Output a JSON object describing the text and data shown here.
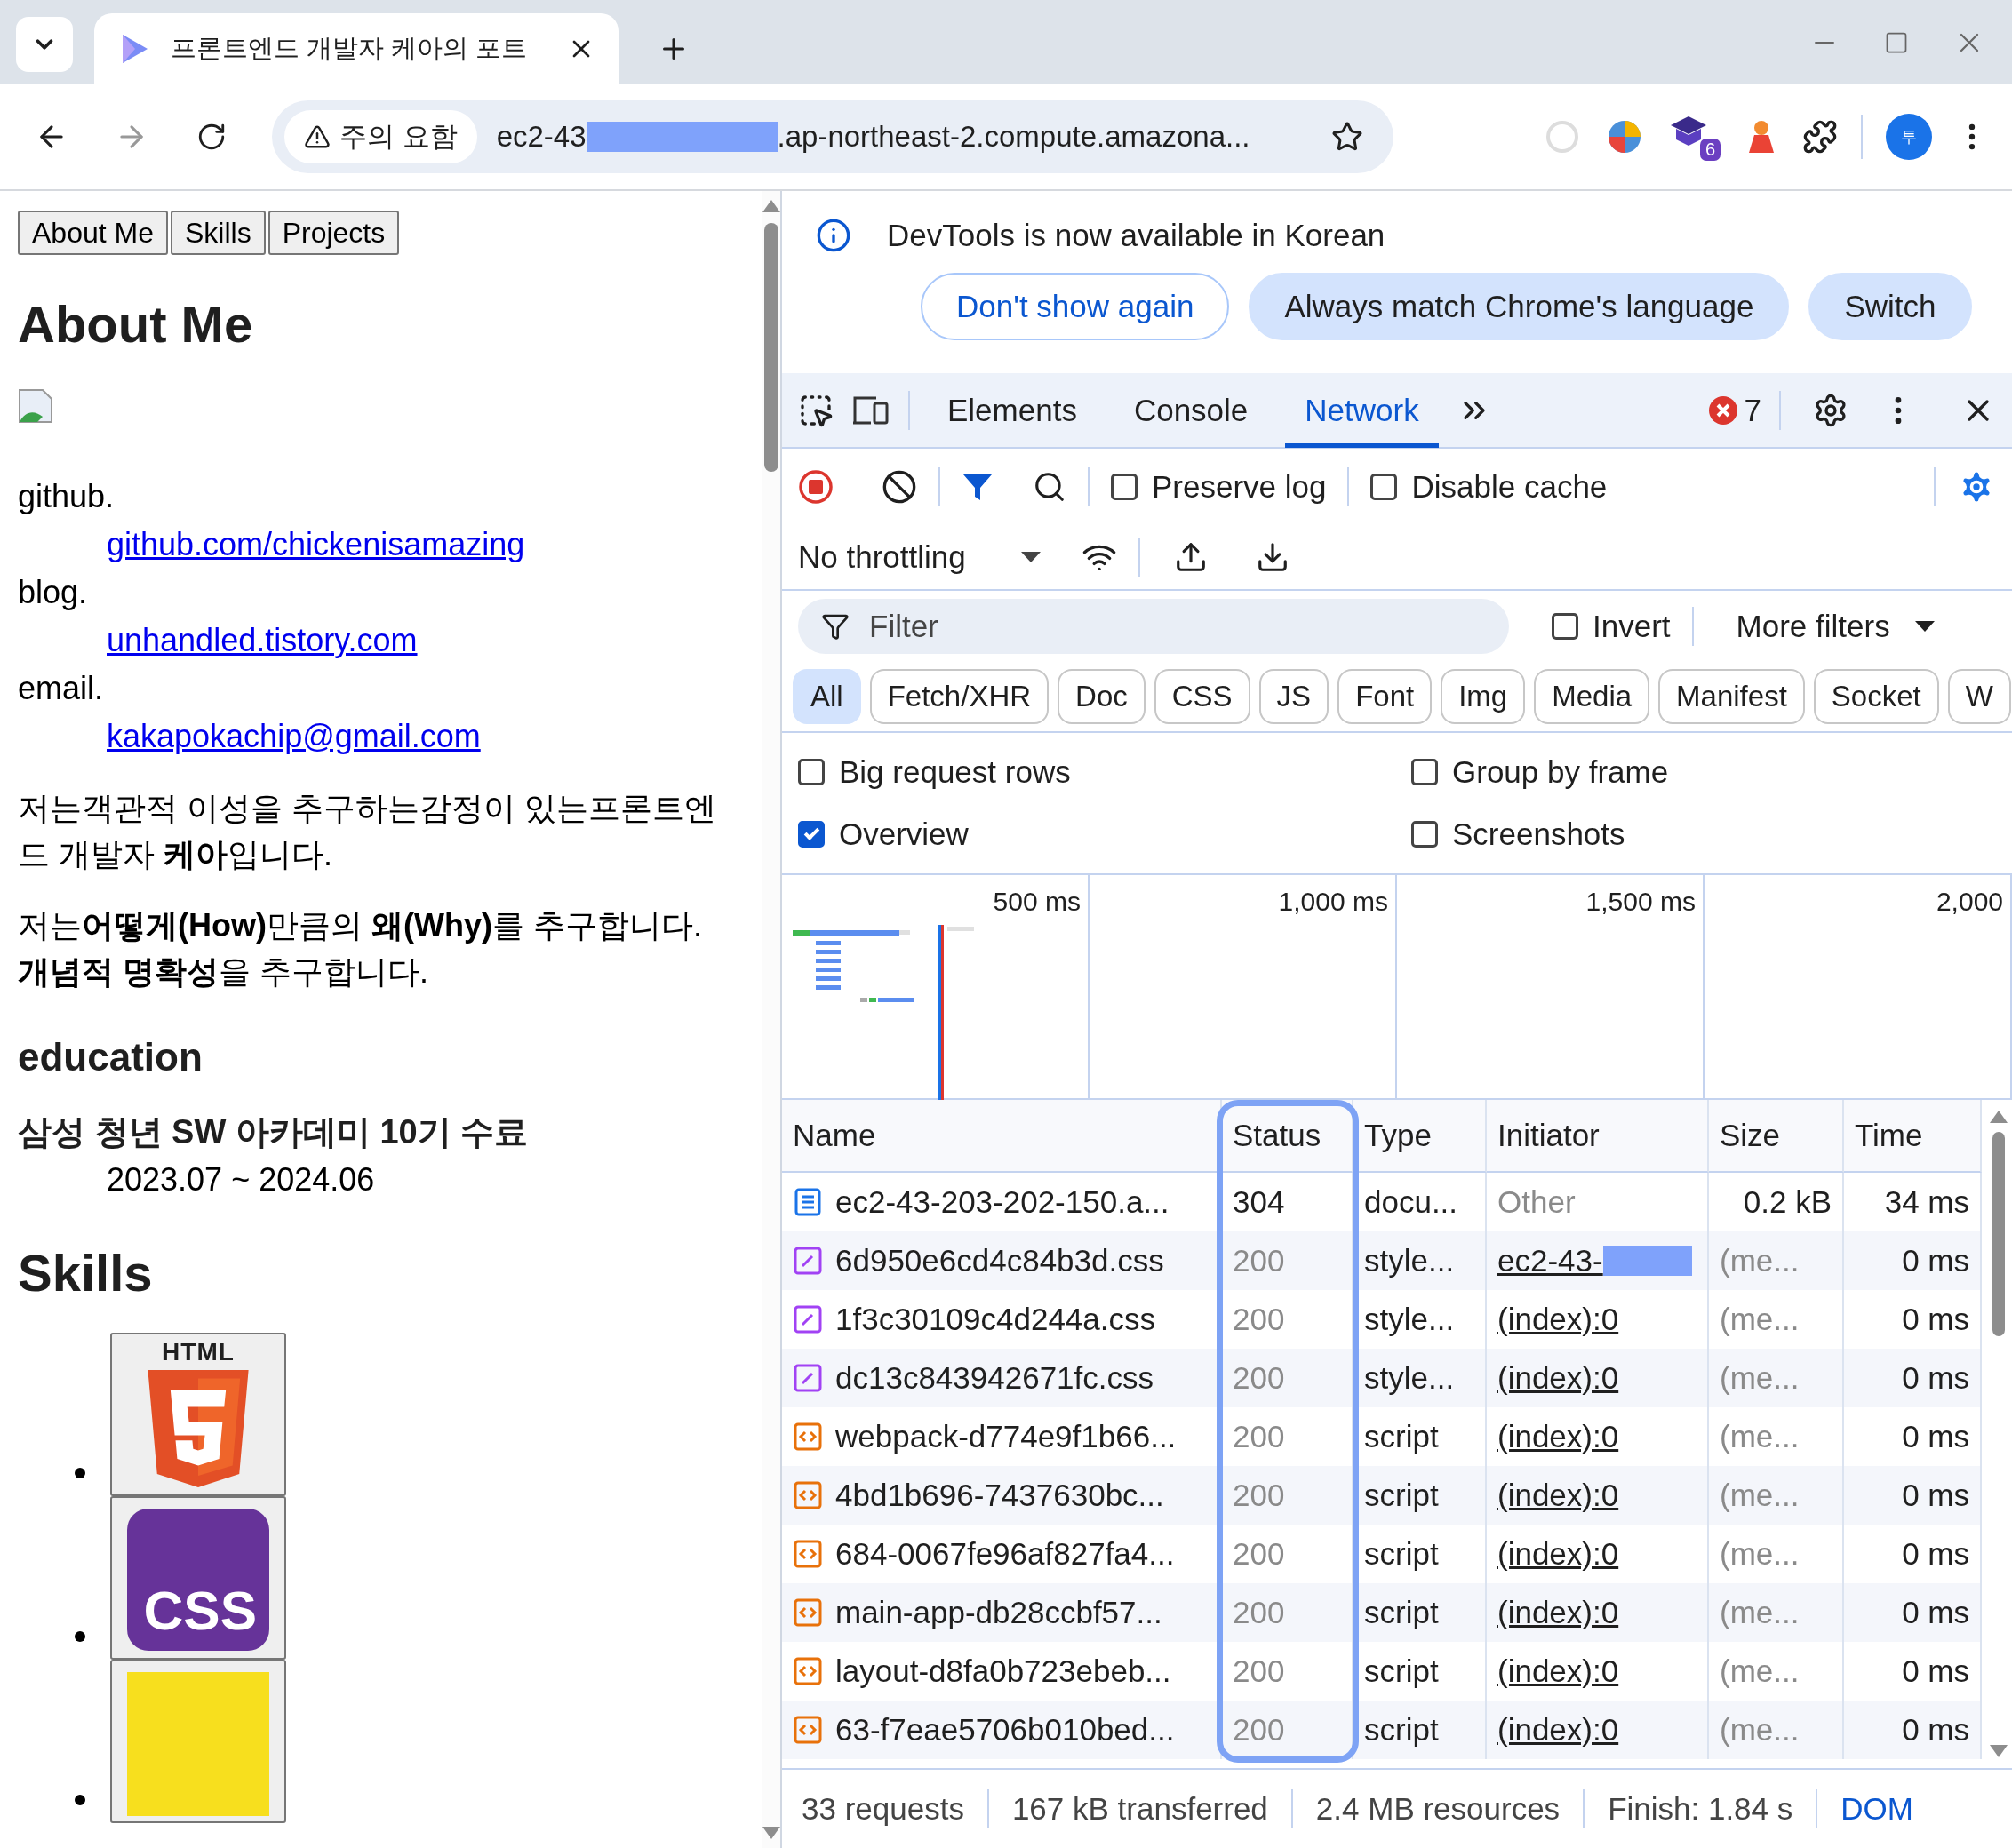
{
  "browser": {
    "tab": {
      "title": "프론트엔드 개발자 케아의 포트"
    },
    "address": {
      "security_label": "주의 요함",
      "url_prefix": "ec2-43",
      "url_suffix": ".ap-northeast-2.compute.amazona..."
    },
    "extensions_badge": "6",
    "profile_initial": "투"
  },
  "page": {
    "nav_buttons": [
      "About Me",
      "Skills",
      "Projects"
    ],
    "heading": "About Me",
    "contacts": [
      {
        "label": "github.",
        "link": "github.com/chickenisamazing"
      },
      {
        "label": "blog.",
        "link": "unhandled.tistory.com"
      },
      {
        "label": "email.",
        "link": "kakapokachip@gmail.com"
      }
    ],
    "paragraphs": [
      "저는객관적 이성을 추구하는감정이 있는프론트엔드 개발자 **케아**입니다.",
      "저는**어떻게(How)**만큼의 **왜(Why)**를 추구합니다.**개념적 명확성**을 추구합니다."
    ],
    "education_heading": "education",
    "education": {
      "title": "삼성 청년 SW 아카데미 10기 수료",
      "period": "2023.07 ~ 2024.06"
    },
    "skills_heading": "Skills",
    "skills": [
      {
        "kind": "html",
        "label": "HTML"
      },
      {
        "kind": "css",
        "label": "CSS"
      },
      {
        "kind": "js"
      }
    ]
  },
  "devtools": {
    "banner": {
      "message": "DevTools is now available in Korean",
      "buttons": [
        {
          "label": "Don't show again",
          "kind": "outline"
        },
        {
          "label": "Always match Chrome's language",
          "kind": "filled"
        },
        {
          "label": "Switch",
          "kind": "filled"
        }
      ]
    },
    "tabs": [
      {
        "label": "Elements",
        "selected": false
      },
      {
        "label": "Console",
        "selected": false
      },
      {
        "label": "Network",
        "selected": true
      }
    ],
    "error_count": "7",
    "preserve_log": {
      "label": "Preserve log",
      "checked": false
    },
    "disable_cache": {
      "label": "Disable cache",
      "checked": false
    },
    "throttling": "No throttling",
    "filter": {
      "placeholder": "Filter"
    },
    "invert": {
      "label": "Invert",
      "checked": false
    },
    "more_filters": "More filters",
    "type_filters": [
      {
        "label": "All",
        "selected": true
      },
      {
        "label": "Fetch/XHR",
        "selected": false
      },
      {
        "label": "Doc",
        "selected": false
      },
      {
        "label": "CSS",
        "selected": false
      },
      {
        "label": "JS",
        "selected": false
      },
      {
        "label": "Font",
        "selected": false
      },
      {
        "label": "Img",
        "selected": false
      },
      {
        "label": "Media",
        "selected": false
      },
      {
        "label": "Manifest",
        "selected": false
      },
      {
        "label": "Socket",
        "selected": false
      },
      {
        "label": "W",
        "selected": false
      }
    ],
    "options": [
      {
        "label": "Big request rows",
        "checked": false
      },
      {
        "label": "Group by frame",
        "checked": false
      },
      {
        "label": "Overview",
        "checked": true
      },
      {
        "label": "Screenshots",
        "checked": false
      }
    ],
    "overview_ticks": [
      "500 ms",
      "1,000 ms",
      "1,500 ms",
      "2,000"
    ],
    "table": {
      "columns": [
        {
          "label": "Name",
          "highlighted": false
        },
        {
          "label": "Status",
          "highlighted": true
        },
        {
          "label": "Type",
          "highlighted": false
        },
        {
          "label": "Initiator",
          "highlighted": false
        },
        {
          "label": "Size",
          "highlighted": false
        },
        {
          "label": "Time",
          "highlighted": false
        }
      ],
      "rows": [
        {
          "kind": "document",
          "name": "ec2-43-203-202-150.a...",
          "status": "304",
          "cached": false,
          "type": "docu...",
          "initiator": "Other",
          "initiator_link": false,
          "initiator_redacted": false,
          "size": "0.2 kB",
          "time": "34 ms"
        },
        {
          "kind": "stylesheet",
          "name": "6d950e6cd4c84b3d.css",
          "status": "200",
          "cached": true,
          "type": "style...",
          "initiator": "ec2-43-",
          "initiator_link": true,
          "initiator_redacted": true,
          "size": "(me...",
          "time": "0 ms"
        },
        {
          "kind": "stylesheet",
          "name": "1f3c30109c4d244a.css",
          "status": "200",
          "cached": true,
          "type": "style...",
          "initiator": "(index):0",
          "initiator_link": true,
          "initiator_redacted": false,
          "size": "(me...",
          "time": "0 ms"
        },
        {
          "kind": "stylesheet",
          "name": "dc13c843942671fc.css",
          "status": "200",
          "cached": true,
          "type": "style...",
          "initiator": "(index):0",
          "initiator_link": true,
          "initiator_redacted": false,
          "size": "(me...",
          "time": "0 ms"
        },
        {
          "kind": "script",
          "name": "webpack-d774e9f1b66...",
          "status": "200",
          "cached": true,
          "type": "script",
          "initiator": "(index):0",
          "initiator_link": true,
          "initiator_redacted": false,
          "size": "(me...",
          "time": "0 ms"
        },
        {
          "kind": "script",
          "name": "4bd1b696-7437630bc...",
          "status": "200",
          "cached": true,
          "type": "script",
          "initiator": "(index):0",
          "initiator_link": true,
          "initiator_redacted": false,
          "size": "(me...",
          "time": "0 ms"
        },
        {
          "kind": "script",
          "name": "684-0067fe96af827fa4...",
          "status": "200",
          "cached": true,
          "type": "script",
          "initiator": "(index):0",
          "initiator_link": true,
          "initiator_redacted": false,
          "size": "(me...",
          "time": "0 ms"
        },
        {
          "kind": "script",
          "name": "main-app-db28ccbf57...",
          "status": "200",
          "cached": true,
          "type": "script",
          "initiator": "(index):0",
          "initiator_link": true,
          "initiator_redacted": false,
          "size": "(me...",
          "time": "0 ms"
        },
        {
          "kind": "script",
          "name": "layout-d8fa0b723ebeb...",
          "status": "200",
          "cached": true,
          "type": "script",
          "initiator": "(index):0",
          "initiator_link": true,
          "initiator_redacted": false,
          "size": "(me...",
          "time": "0 ms"
        },
        {
          "kind": "script",
          "name": "63-f7eae5706b010bed...",
          "status": "200",
          "cached": true,
          "type": "script",
          "initiator": "(index):0",
          "initiator_link": true,
          "initiator_redacted": false,
          "size": "(me...",
          "time": "0 ms"
        }
      ]
    },
    "status_bar": [
      {
        "text": "33 requests",
        "kind": "plain"
      },
      {
        "text": "167 kB transferred",
        "kind": "plain"
      },
      {
        "text": "2.4 MB resources",
        "kind": "plain"
      },
      {
        "text": "Finish: 1.84 s",
        "kind": "plain"
      },
      {
        "text": "DOM",
        "kind": "timing"
      }
    ]
  }
}
